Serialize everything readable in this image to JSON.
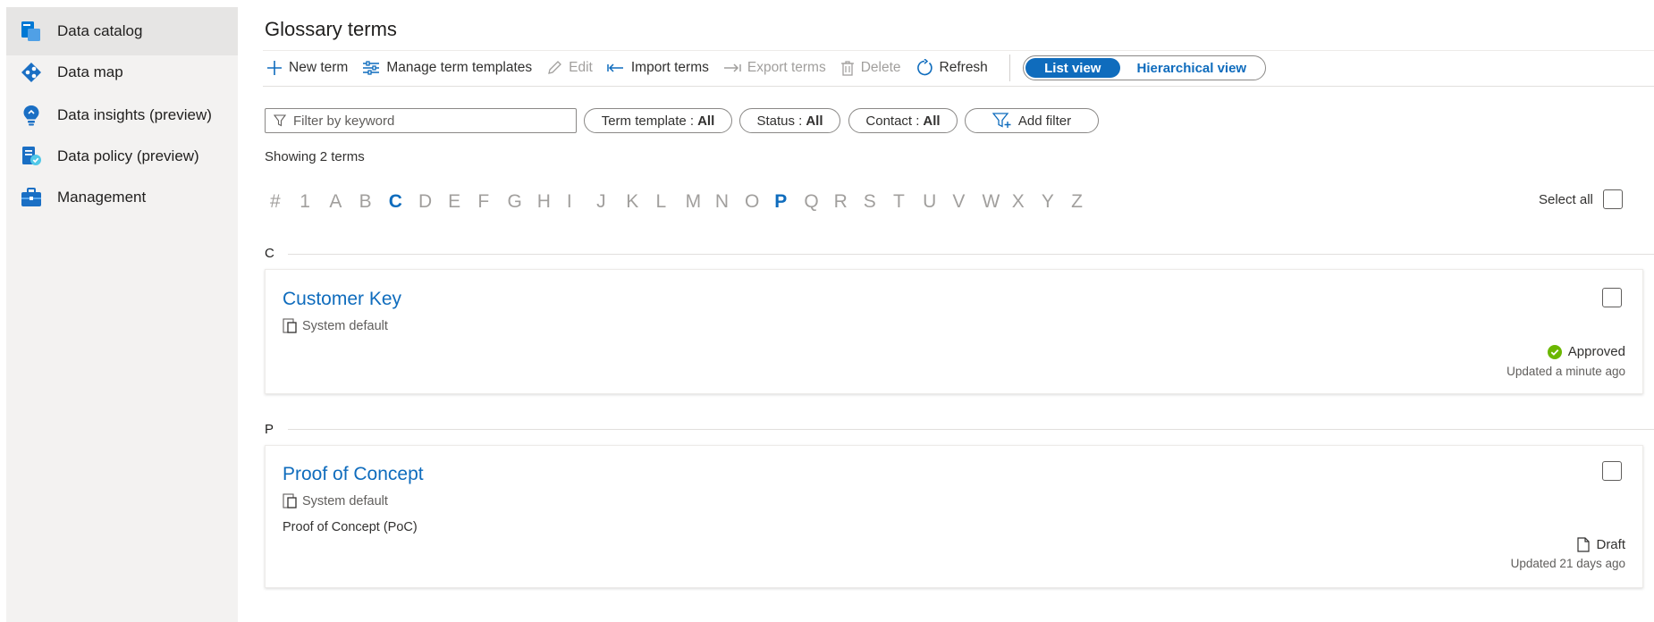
{
  "sidebar": {
    "items": [
      {
        "label": "Data catalog",
        "icon": "data-catalog-icon",
        "active": true
      },
      {
        "label": "Data map",
        "icon": "data-map-icon"
      },
      {
        "label": "Data insights (preview)",
        "icon": "lightbulb-icon"
      },
      {
        "label": "Data policy (preview)",
        "icon": "data-policy-icon"
      },
      {
        "label": "Management",
        "icon": "toolbox-icon"
      }
    ]
  },
  "header": {
    "title": "Glossary terms"
  },
  "toolbar": {
    "new_term": "New term",
    "manage_templates": "Manage term templates",
    "edit": "Edit",
    "import_terms": "Import terms",
    "export_terms": "Export terms",
    "delete": "Delete",
    "refresh": "Refresh",
    "list_view": "List view",
    "hierarchical_view": "Hierarchical view"
  },
  "filters": {
    "keyword_placeholder": "Filter by keyword",
    "term_template": {
      "label": "Term template :",
      "value": "All"
    },
    "status": {
      "label": "Status :",
      "value": "All"
    },
    "contact": {
      "label": "Contact :",
      "value": "All"
    },
    "add_filter": "Add filter"
  },
  "results": {
    "showing": "Showing 2 terms"
  },
  "alphabet": {
    "letters": [
      "#",
      "1",
      "A",
      "B",
      "C",
      "D",
      "E",
      "F",
      "G",
      "H",
      "I",
      "J",
      "K",
      "L",
      "M",
      "N",
      "O",
      "P",
      "Q",
      "R",
      "S",
      "T",
      "U",
      "V",
      "W",
      "X",
      "Y",
      "Z"
    ],
    "active": [
      "C",
      "P"
    ],
    "select_all": "Select all"
  },
  "groups": [
    {
      "letter": "C",
      "terms": [
        {
          "title": "Customer Key",
          "template": "System default",
          "description": "",
          "status": "Approved",
          "updated": "Updated a minute ago"
        }
      ]
    },
    {
      "letter": "P",
      "terms": [
        {
          "title": "Proof of Concept",
          "template": "System default",
          "description": "Proof of Concept (PoC)",
          "status": "Draft",
          "updated": "Updated 21 days ago"
        }
      ]
    }
  ],
  "colors": {
    "accent": "#0f6cbd",
    "approved": "#6bb700",
    "sidebar_bg": "#f3f2f1"
  }
}
